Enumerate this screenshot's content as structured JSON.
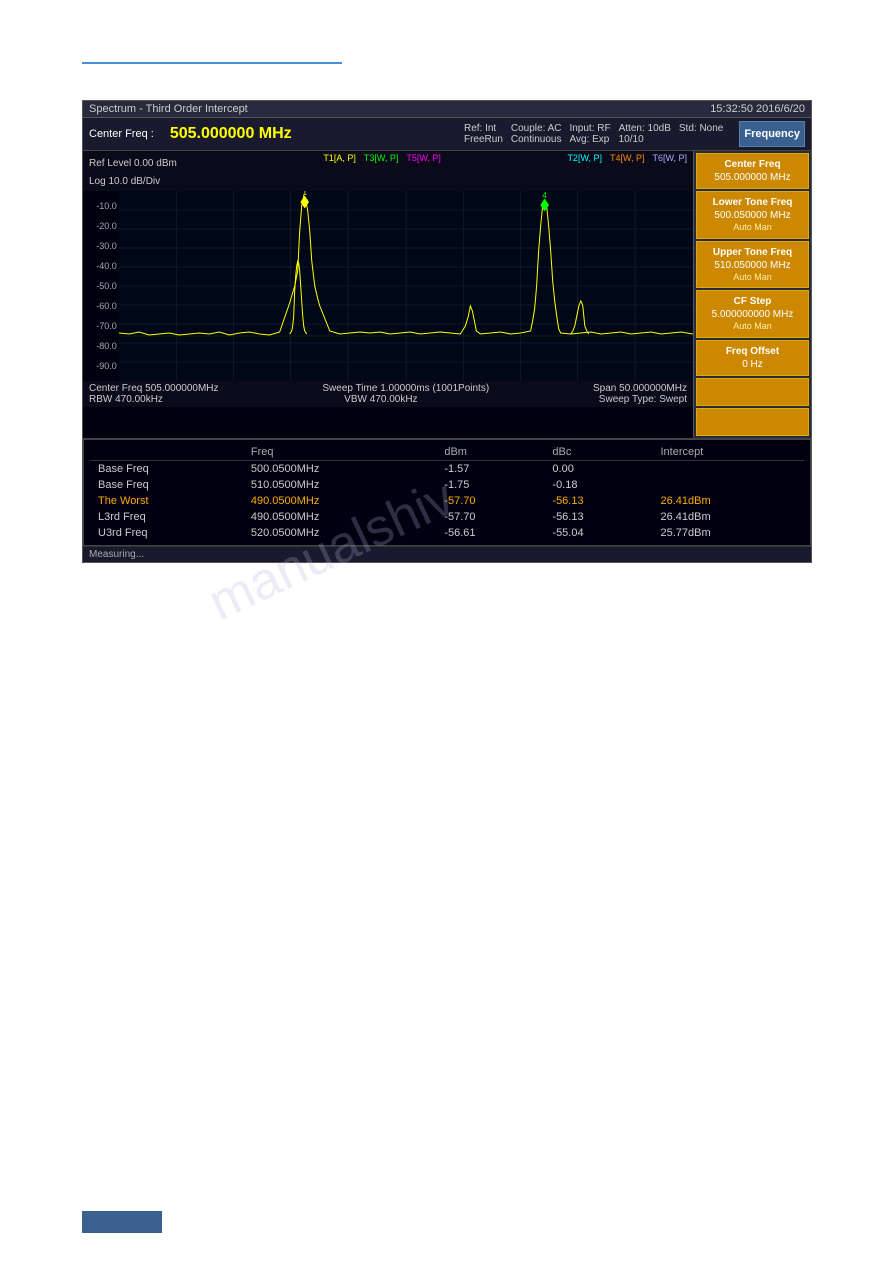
{
  "topLine": {},
  "titleBar": {
    "title": "Spectrum - Third Order Intercept",
    "timestamp": "15:32:50  2016/6/20"
  },
  "statusBar": {
    "centerFreqLabel": "Center Freq :",
    "centerFreqValue": "505.000000 MHz",
    "refLabel": "Ref: Int",
    "sweepLabel": "FreeRun",
    "coupleLabel": "Couple: AC",
    "continuousLabel": "Continuous",
    "inputLabel": "Input: RF",
    "avgLabel": "Avg: Exp",
    "attenLabel": "Atten: 10dB",
    "attenValue": "10/10",
    "stdLabel": "Std: None"
  },
  "chartInfo": {
    "refLevel": "Ref Level 0.00 dBm",
    "logScale": "Log 10.0 dB/Div",
    "traceLabels": [
      {
        "id": "T1",
        "modes": "[A, P]"
      },
      {
        "id": "T3",
        "modes": "[W, P]"
      },
      {
        "id": "T5",
        "modes": "[W, P]"
      },
      {
        "id": "T2",
        "modes": "[W, P]"
      },
      {
        "id": "T4",
        "modes": "[W, P]"
      },
      {
        "id": "T6",
        "modes": "[W, P]"
      }
    ],
    "yLabels": [
      "-10.0",
      "-20.0",
      "-30.0",
      "-40.0",
      "-50.0",
      "-60.0",
      "-70.0",
      "-80.0",
      "-90.0"
    ]
  },
  "chartFooter": {
    "centerFreq": "Center Freq 505.000000MHz",
    "rbw": "RBW 470.00kHz",
    "sweepTime": "Sweep Time 1.00000ms (1001Points)",
    "vbw": "VBW 470.00kHz",
    "span": "Span 50.000000MHz",
    "sweepType": "Sweep Type: Swept"
  },
  "rightPanel": {
    "mainBtn": "Frequency",
    "buttons": [
      {
        "label": "Center Freq",
        "value": "505.000000 MHz",
        "sub": ""
      },
      {
        "label": "Lower Tone Freq",
        "value": "500.050000 MHz",
        "sub": "Auto  Man"
      },
      {
        "label": "Upper Tone Freq",
        "value": "510.050000 MHz",
        "sub": "Auto  Man"
      },
      {
        "label": "CF Step",
        "value": "5.000000000 MHz",
        "sub": "Auto  Man"
      },
      {
        "label": "Freq Offset",
        "value": "0 Hz",
        "sub": ""
      }
    ]
  },
  "dataTable": {
    "headers": [
      "",
      "Freq",
      "dBm",
      "dBc",
      "Intercept"
    ],
    "rows": [
      {
        "type": "normal",
        "name": "Base Freq",
        "freq": "500.0500MHz",
        "dbm": "-1.57",
        "dbc": "0.00",
        "intercept": ""
      },
      {
        "type": "normal",
        "name": "Base Freq",
        "freq": "510.0500MHz",
        "dbm": "-1.75",
        "dbc": "-0.18",
        "intercept": ""
      },
      {
        "type": "worst",
        "name": "The Worst",
        "freq": "490.0500MHz",
        "dbm": "-57.70",
        "dbc": "-56.13",
        "intercept": "26.41dBm"
      },
      {
        "type": "normal",
        "name": "L3rd  Freq",
        "freq": "490.0500MHz",
        "dbm": "-57.70",
        "dbc": "-56.13",
        "intercept": "26.41dBm"
      },
      {
        "type": "normal",
        "name": "U3rd  Freq",
        "freq": "520.0500MHz",
        "dbm": "-56.61",
        "dbc": "-55.04",
        "intercept": "25.77dBm"
      }
    ]
  },
  "statusLine": "Measuring..."
}
